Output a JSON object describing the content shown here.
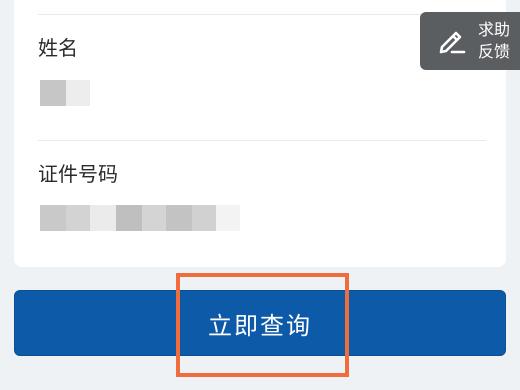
{
  "form": {
    "name_label": "姓名",
    "id_label": "证件号码"
  },
  "help": {
    "line1": "求助",
    "line2": "反馈",
    "icon": "edit-icon"
  },
  "query_button": {
    "label": "立即查询",
    "color": "#0d5aa9"
  },
  "annotation": {
    "color": "#f06c3c"
  }
}
